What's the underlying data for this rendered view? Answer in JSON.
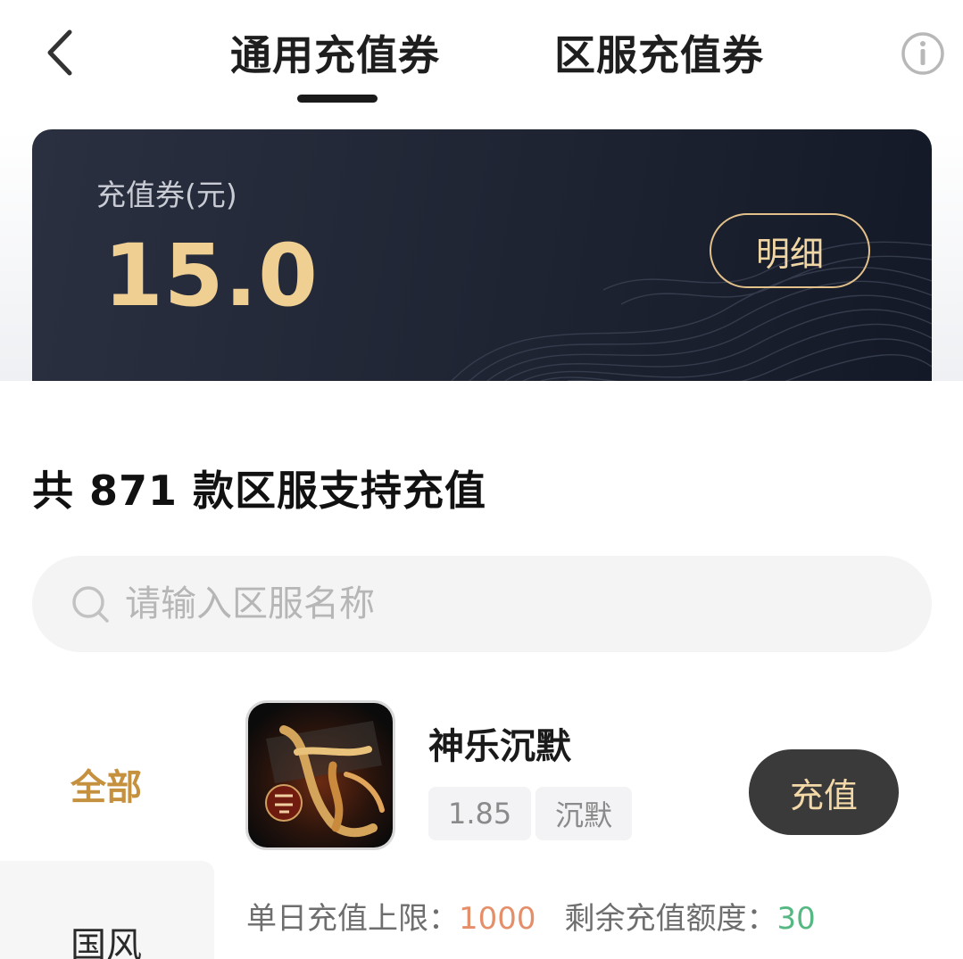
{
  "header": {
    "tabs": [
      {
        "label": "通用充值券",
        "active": true
      },
      {
        "label": "区服充值券",
        "active": false
      }
    ],
    "back_icon": "chevron-left-icon",
    "info_icon": "info-circle-icon"
  },
  "balance": {
    "label": "充值券(元)",
    "value": "15.0",
    "detail_button": "明细"
  },
  "count_heading": "共 871 款区服支持充值",
  "search": {
    "placeholder": "请输入区服名称",
    "icon": "search-icon"
  },
  "sidebar": {
    "items": [
      {
        "label": "全部",
        "active": true
      },
      {
        "label": "国风",
        "active": false
      }
    ]
  },
  "game": {
    "name": "神乐沉默",
    "tags": [
      "1.85",
      "沉默"
    ],
    "recharge_button": "充值",
    "daily_limit_label": "单日充值上限：",
    "daily_limit_value": "1000",
    "remaining_label": "剩余充值额度：",
    "remaining_value": "30"
  },
  "colors": {
    "accent_gold": "#c5913f",
    "balance_gold": "#f0cf92",
    "limit_orange": "#e58e6a",
    "remain_green": "#55b882",
    "card_dark": "#1e2432"
  }
}
